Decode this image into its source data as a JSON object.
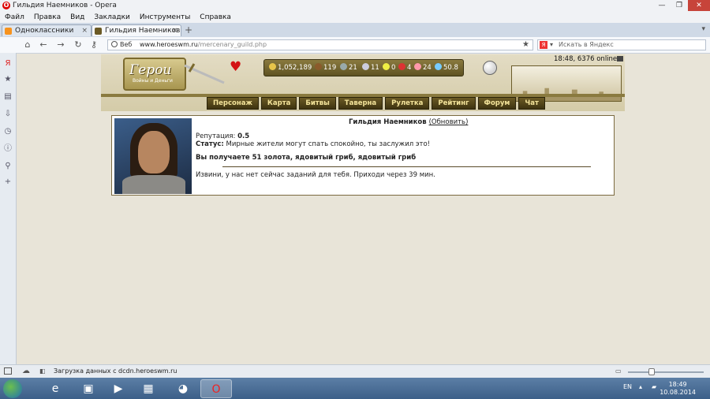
{
  "window": {
    "title": "Гильдия Наемников - Opera",
    "controls": [
      "—",
      "❐",
      "✕"
    ]
  },
  "menu": [
    "Файл",
    "Правка",
    "Вид",
    "Закладки",
    "Инструменты",
    "Справка"
  ],
  "tabs": [
    {
      "label": "Одноклассники",
      "icon": "odnoklassniki-icon",
      "color": "#f7931e"
    },
    {
      "label": "Гильдия Наемников",
      "icon": "heroes-icon",
      "color": "#6b5a25"
    }
  ],
  "address": {
    "web_label": "Веб",
    "url_domain": "www.heroeswm.ru",
    "url_path": "/mercenary_guild.php",
    "search_placeholder": "Искать в Яндекс"
  },
  "game": {
    "logo_title": "Герои",
    "logo_subtitle": "Войны и Деньги",
    "resources": {
      "gold": "1,052,189",
      "wood": "119",
      "ore": "21",
      "mercury": "11",
      "sulfur": "0",
      "crystals": "4",
      "gems": "24",
      "diamonds": "50.8"
    },
    "online": "18:48, 6376 online",
    "nav": [
      "Персонаж",
      "Карта",
      "Битвы",
      "Таверна",
      "Рулетка",
      "Рейтинг",
      "Форум",
      "Чат"
    ]
  },
  "guild": {
    "title": "Гильдия Наемников",
    "refresh_label": "(Обновить)",
    "reputation_label": "Репутация:",
    "reputation_value": "0.5",
    "status_label": "Статус:",
    "status_text": "Мирные жители могут спать спокойно, ты заслужил это!",
    "reward": "Вы получаете 51 золота, ядовитый гриб, ядовитый гриб",
    "message": "Извини, у нас нет сейчас заданий для тебя. Приходи через 39 мин."
  },
  "statusbar": {
    "text": "Загрузка данных с dcdn.heroeswm.ru"
  },
  "taskbar": {
    "lang": "EN",
    "time": "18:49",
    "date": "10.08.2014"
  }
}
